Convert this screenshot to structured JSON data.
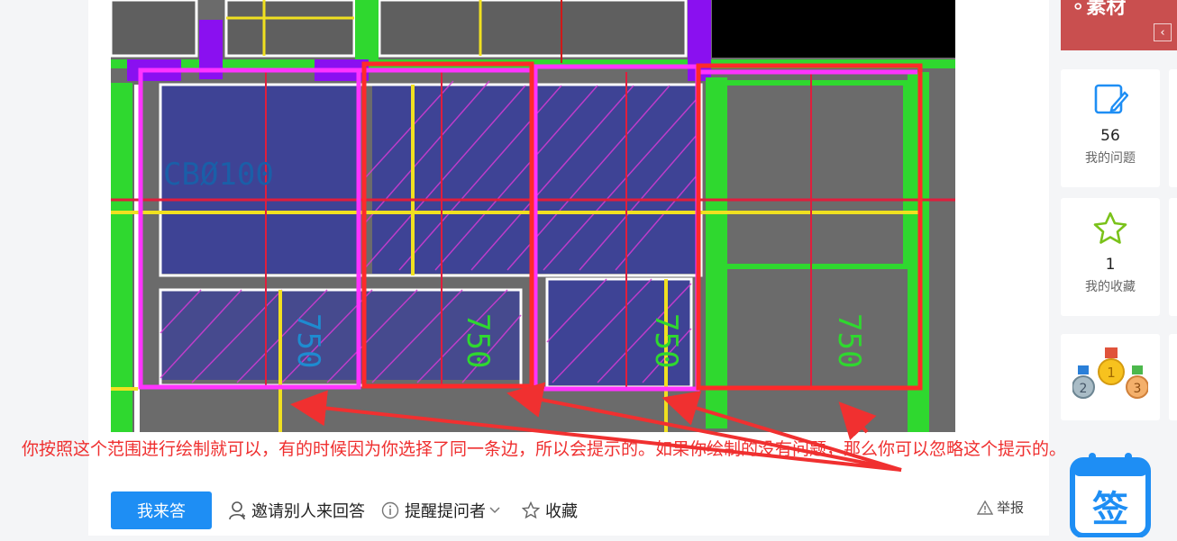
{
  "banner": {
    "text": "⚬素材",
    "collapse_icon": "chevron-left-icon"
  },
  "reply": {
    "text": "你按照这个范围进行绘制就可以，有的时候因为你选择了同一条边，所以会提示的。如果你绘制的没有问题，那么你可以忽略这个提示的。"
  },
  "cad": {
    "labels": [
      "CBØ100",
      "750",
      "750",
      "750",
      "750"
    ]
  },
  "actions": {
    "answer": "我来答",
    "invite": "邀请别人来回答",
    "remind": "提醒提问者",
    "favorite": "收藏",
    "report": "举报"
  },
  "sidebar": {
    "questions": {
      "count": "56",
      "label": "我的问题",
      "icon": "edit-note-icon"
    },
    "favorites": {
      "count": "1",
      "label": "我的收藏",
      "icon": "star-icon"
    },
    "medals_icon": "medals-icon",
    "signin": {
      "label": "签",
      "icon": "calendar-icon"
    }
  },
  "colors": {
    "accent": "#1e8ef4",
    "reply_text": "#ef2f2f",
    "banner": "#c94f4f"
  }
}
